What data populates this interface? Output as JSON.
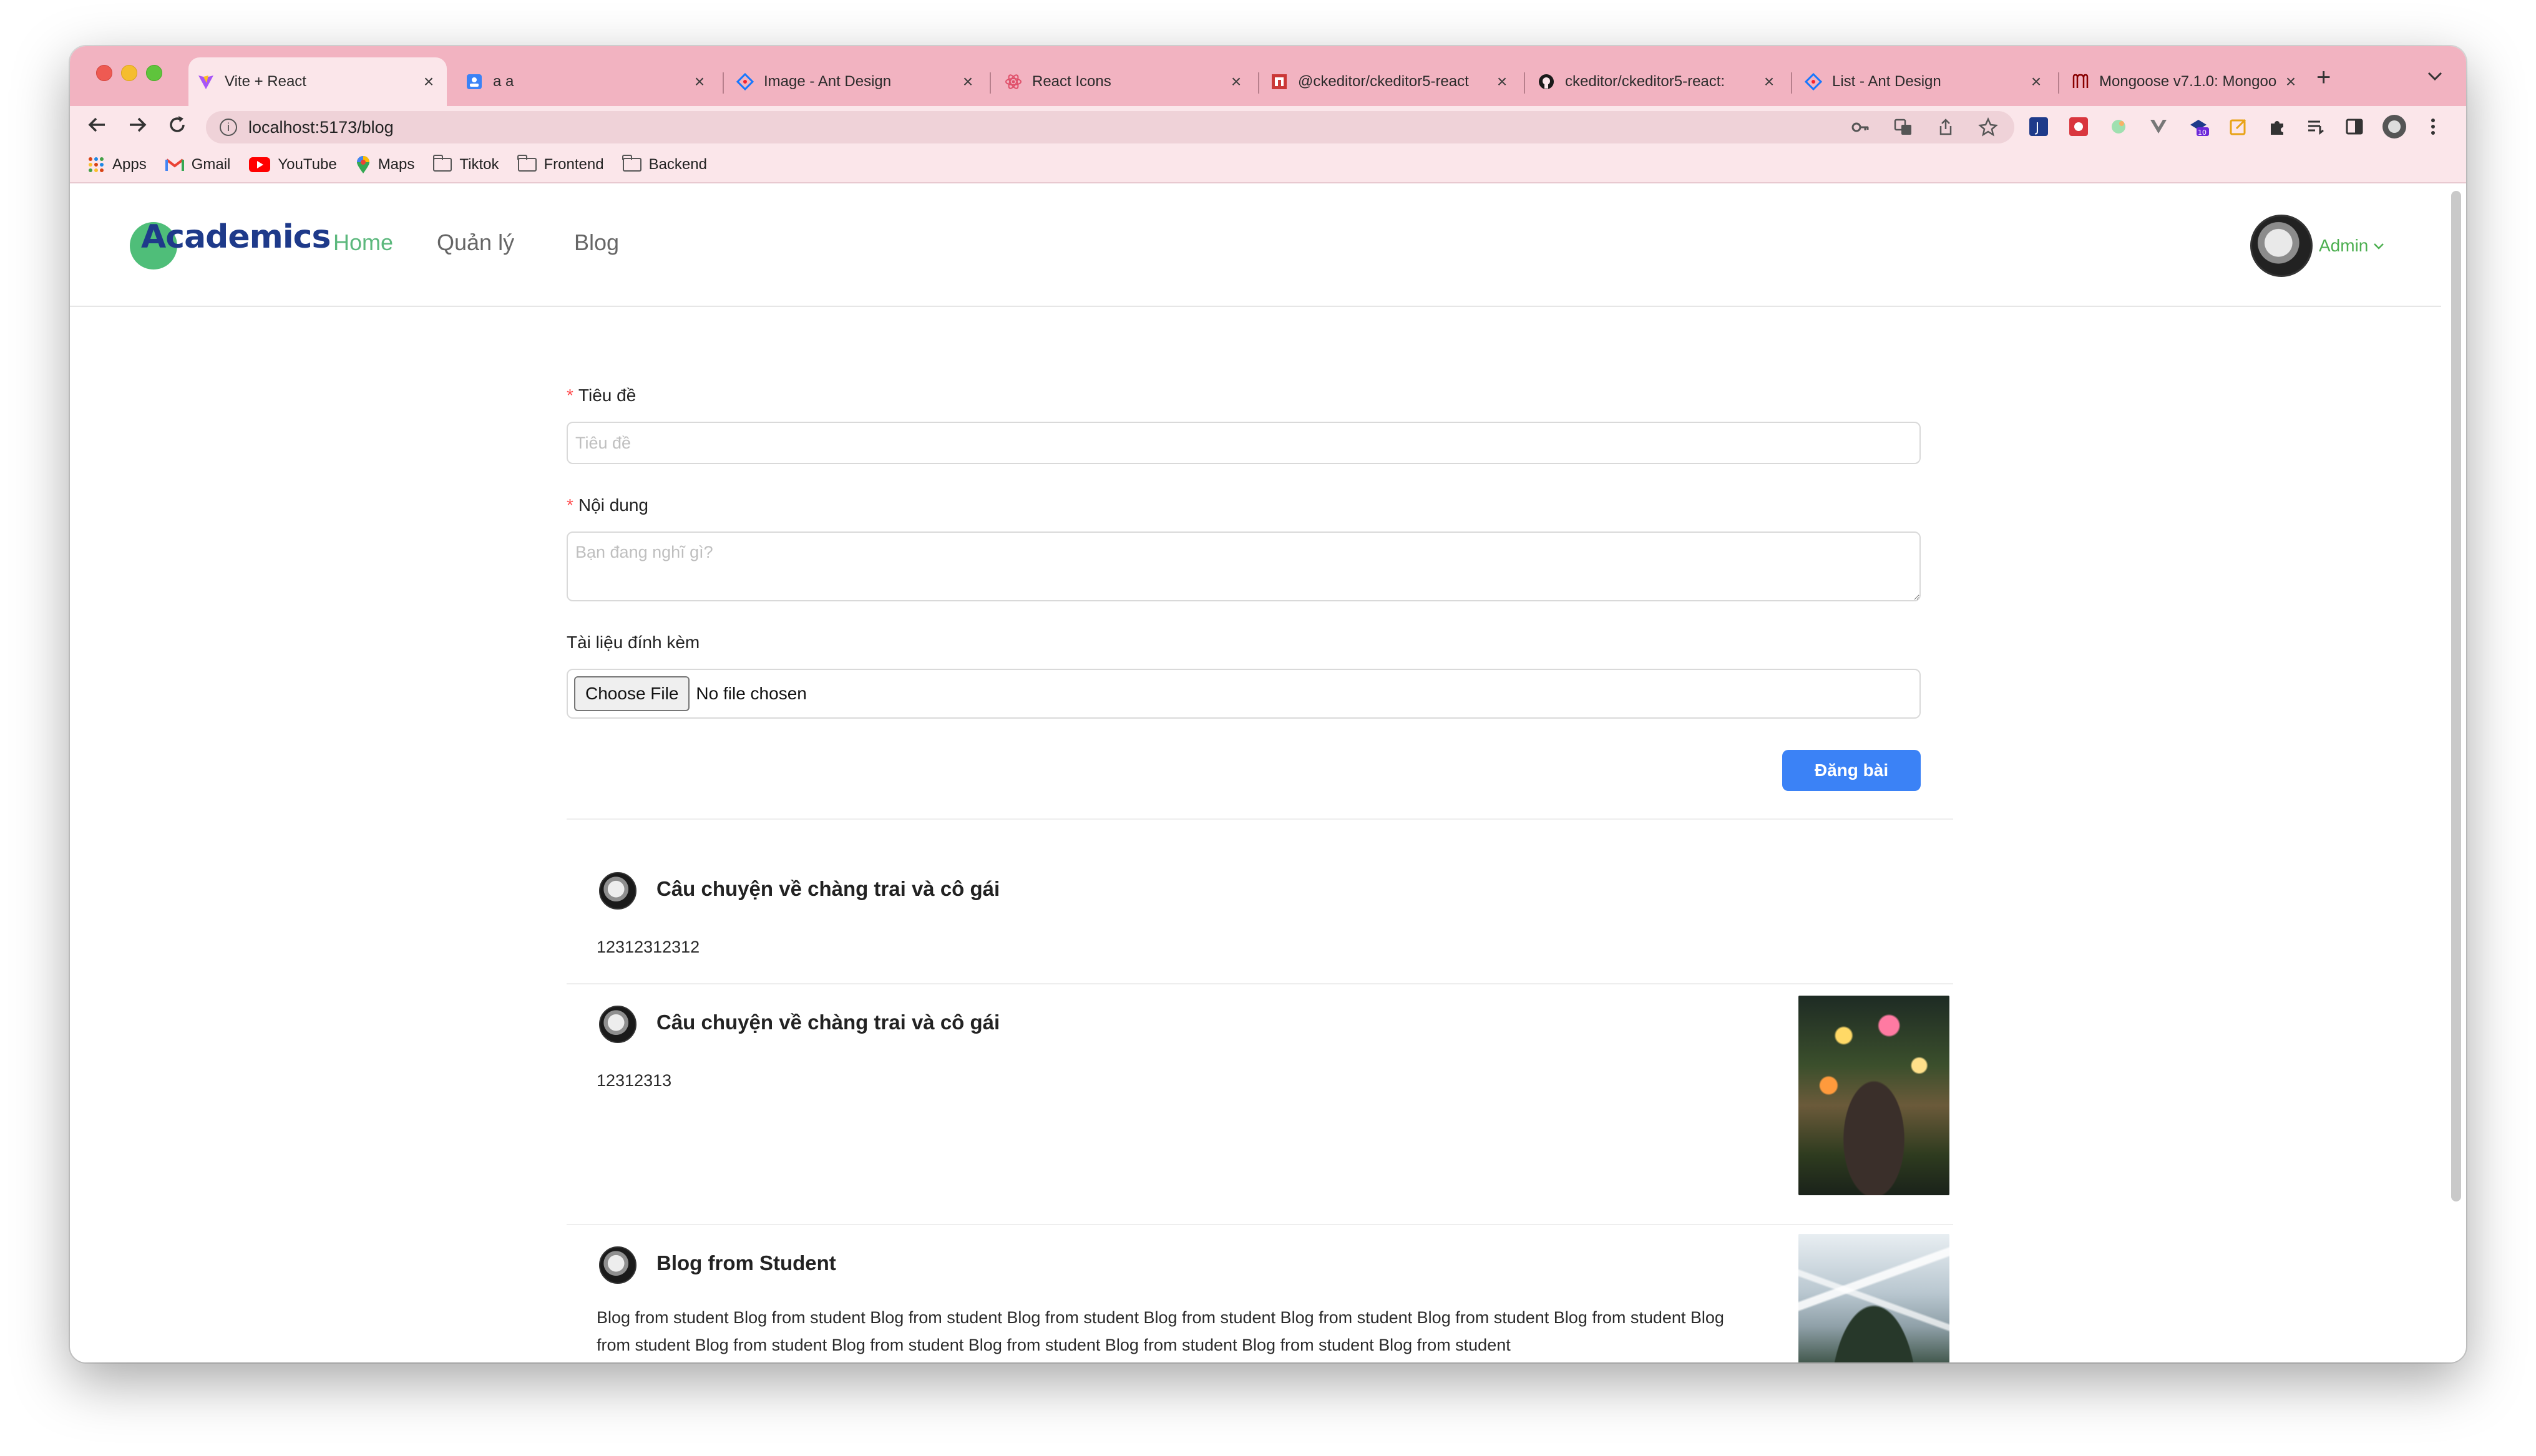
{
  "browser": {
    "tabs": [
      {
        "title": "Vite + React",
        "icon": "vite-icon",
        "active": true
      },
      {
        "title": "a a",
        "icon": "app-icon"
      },
      {
        "title": "Image - Ant Design",
        "icon": "antd-icon"
      },
      {
        "title": "React Icons",
        "icon": "react-icon"
      },
      {
        "title": "@ckeditor/ckeditor5-react",
        "icon": "npm-icon"
      },
      {
        "title": "ckeditor/ckeditor5-react:",
        "icon": "github-icon"
      },
      {
        "title": "List - Ant Design",
        "icon": "antd-icon"
      },
      {
        "title": "Mongoose v7.1.0: Mongoo",
        "icon": "mongoose-icon"
      }
    ],
    "tab_close": "×",
    "new_tab": "+",
    "url": "localhost:5173/blog",
    "bookmarks": [
      {
        "label": "Apps",
        "icon": "apps-grid-icon"
      },
      {
        "label": "Gmail",
        "icon": "gmail-icon"
      },
      {
        "label": "YouTube",
        "icon": "youtube-icon"
      },
      {
        "label": "Maps",
        "icon": "maps-icon"
      },
      {
        "label": "Tiktok",
        "icon": "folder-icon"
      },
      {
        "label": "Frontend",
        "icon": "folder-icon"
      },
      {
        "label": "Backend",
        "icon": "folder-icon"
      }
    ]
  },
  "app": {
    "logo": "Academics",
    "nav": [
      "Home",
      "Quản lý",
      "Blog"
    ],
    "user": "Admin",
    "accent": "#5cb87d"
  },
  "form": {
    "title_label": "Tiêu đề",
    "title_placeholder": "Tiêu đề",
    "content_label": "Nội dung",
    "content_placeholder": "Bạn đang nghĩ gì?",
    "attachment_label": "Tài liệu đính kèm",
    "file_button": "Choose File",
    "file_status": "No file chosen",
    "submit_label": "Đăng bài",
    "submit_color": "#3b82f6"
  },
  "posts": [
    {
      "title": "Câu chuyện về chàng trai và cô gái",
      "body": "12312312312"
    },
    {
      "title": "Câu chuyện về chàng trai và cô gái",
      "body": "12312313"
    },
    {
      "title": "Blog from Student",
      "body": "Blog from student Blog from student Blog from student Blog from student Blog from student Blog from student Blog from student Blog from student Blog from student Blog from student Blog from student Blog from student Blog from student Blog from student Blog from student"
    }
  ]
}
